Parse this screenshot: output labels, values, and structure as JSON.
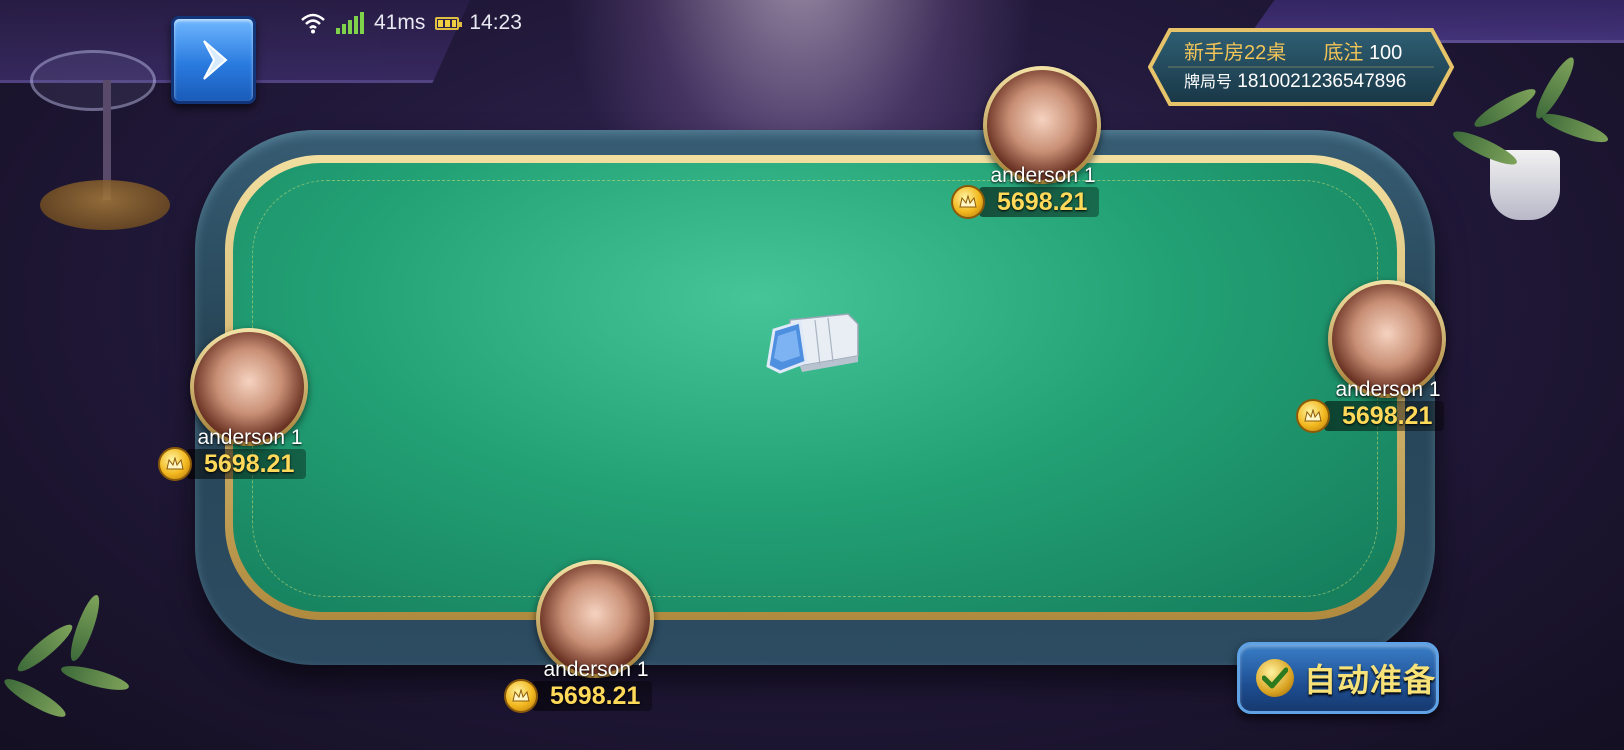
{
  "status_bar": {
    "wifi_icon": "wifi-icon",
    "signal_icon": "signal-bars-icon",
    "latency": "41ms",
    "battery_icon": "battery-icon",
    "time": "14:23"
  },
  "menu_button": {
    "icon": "chevron-right-icon"
  },
  "room_info": {
    "room_name": "新手房22桌",
    "bet_label": "底注",
    "bet_value": "100",
    "game_id_label": "牌局号",
    "game_id": "1810021236547896"
  },
  "players": [
    {
      "seat": "top",
      "name": "anderson 1",
      "balance": "5698.21"
    },
    {
      "seat": "right",
      "name": "anderson 1",
      "balance": "5698.21"
    },
    {
      "seat": "left",
      "name": "anderson 1",
      "balance": "5698.21"
    },
    {
      "seat": "bottom",
      "name": "anderson 1",
      "balance": "5698.21"
    }
  ],
  "table": {
    "deck_icon": "card-deck-icon",
    "felt_color": "#23a276"
  },
  "auto_ready": {
    "label": "自动准备",
    "icon": "check-icon"
  },
  "colors": {
    "accent_gold": "#ffd95a",
    "button_blue": "#2a7be0"
  }
}
